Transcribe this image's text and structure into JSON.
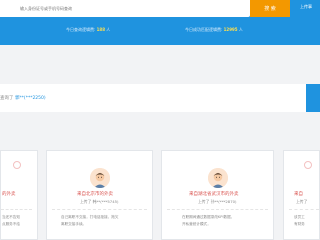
{
  "search": {
    "placeholder": "输入身份证号或手机号码查询",
    "button_label": "搜 索",
    "upload_label": "上传事"
  },
  "stats": {
    "today_query_prefix": "今日查询逻辑费:",
    "today_query_value": "188",
    "today_query_unit": "人",
    "today_match_prefix": "今日成功匹配逻辑费:",
    "today_match_value": "12995",
    "today_match_unit": "人"
  },
  "query_line": {
    "prefix": "查询了",
    "masked": "郭**(***2250)"
  },
  "cards": [
    {
      "title": "的外卖",
      "sub": "",
      "desc": [
        "当还不告知",
        "点服务不给"
      ]
    },
    {
      "title": "来自北京市的外卖",
      "sub": "上传了 韩**(***5745)",
      "desc": [
        "自己离职不交接，打电话拒接，拖欠",
        "离职交接手续。"
      ]
    },
    {
      "title": "来自湖北省武汉市的外卖",
      "sub": "上传了 孙**(***2870)",
      "desc": [
        "在职期间通过数据录改KPI数据，",
        "开私营统计模式，"
      ]
    },
    {
      "title": "来自",
      "sub": "上传了",
      "desc": [
        "该员工",
        "有财务"
      ]
    }
  ]
}
